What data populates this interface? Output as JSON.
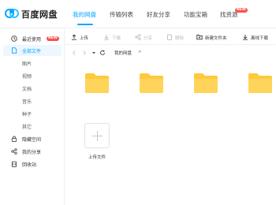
{
  "app": {
    "brand": "百度网盘",
    "brand_color": "#06a7ff",
    "top_tabs": [
      {
        "label": "我的网盘",
        "active": true
      },
      {
        "label": "传输列表",
        "active": false
      },
      {
        "label": "好友分享",
        "active": false
      },
      {
        "label": "功能宝箱",
        "active": false
      },
      {
        "label": "找资源",
        "active": false,
        "badge": "NEW"
      }
    ]
  },
  "sidebar": {
    "items": [
      {
        "label": "最近使用",
        "icon": "clock-icon",
        "badge": "NEW"
      },
      {
        "label": "全部文件",
        "icon": "file-icon",
        "active": true
      },
      {
        "label": "图片",
        "sub": true
      },
      {
        "label": "视频",
        "sub": true
      },
      {
        "label": "文档",
        "sub": true
      },
      {
        "label": "音乐",
        "sub": true
      },
      {
        "label": "种子",
        "sub": true
      },
      {
        "label": "其它",
        "sub": true
      },
      {
        "label": "隐藏空间",
        "icon": "lock-icon"
      },
      {
        "label": "我的分享",
        "icon": "share-icon"
      },
      {
        "label": "回收站",
        "icon": "trash-icon"
      }
    ]
  },
  "toolbar": {
    "upload": "上传",
    "download": "下载",
    "share": "分享",
    "delete": "删除",
    "new_folder": "新建文件夹",
    "offline_download": "离线下载"
  },
  "path": {
    "crumb": "我的网盘",
    "separator": ">"
  },
  "main": {
    "folder_count": 4,
    "upload_tile_label": "上传文件"
  },
  "colors": {
    "folder": "#ffc93c",
    "badge": "#fa5151",
    "accent": "#06a7ff"
  }
}
